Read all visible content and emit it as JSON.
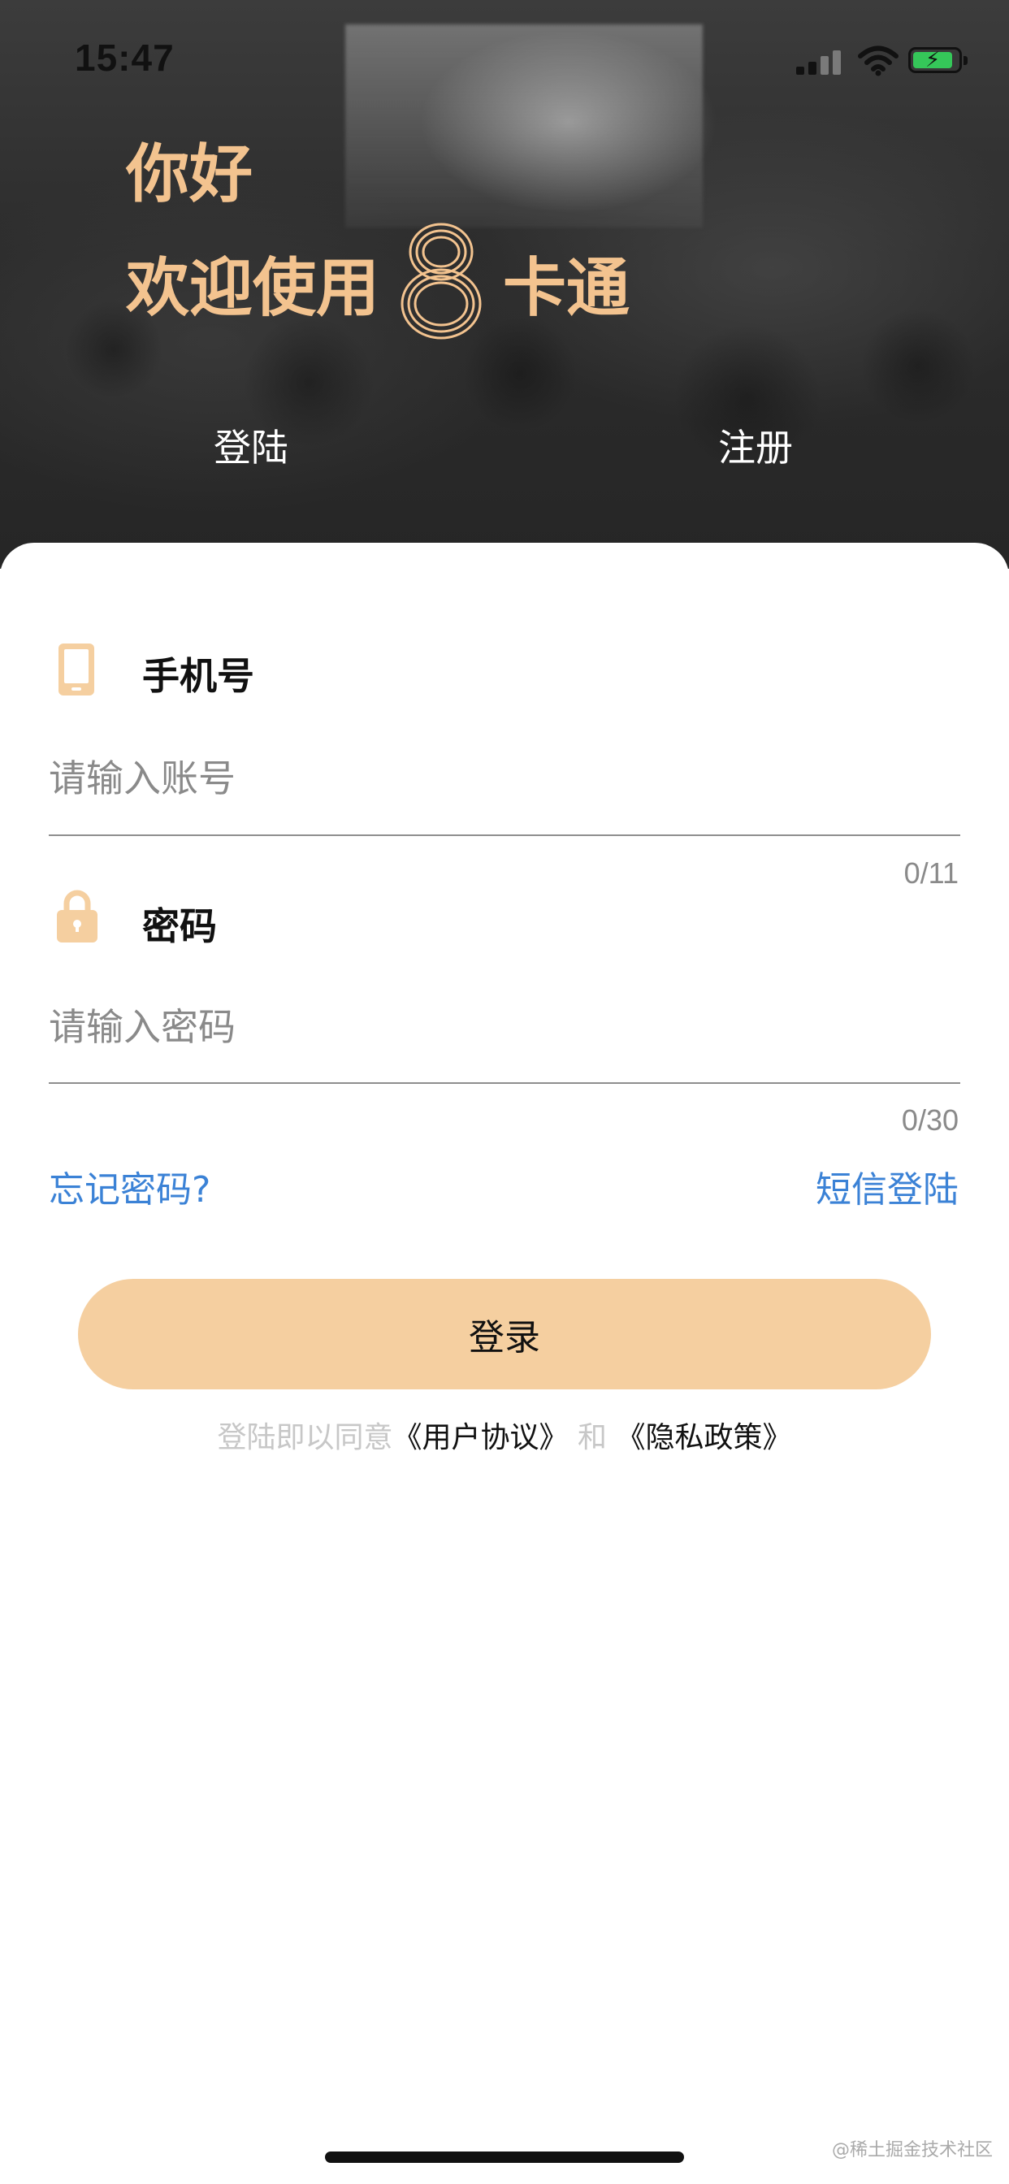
{
  "status_bar": {
    "time": "15:47"
  },
  "header": {
    "greeting_line1": "你好",
    "greeting_prefix": "欢迎使用",
    "greeting_number": "8",
    "greeting_suffix": "卡通",
    "tab_login": "登陆",
    "tab_register": "注册"
  },
  "form": {
    "phone": {
      "label": "手机号",
      "placeholder": "请输入账号",
      "value": "",
      "counter": "0/11",
      "icon": "phone-icon"
    },
    "password": {
      "label": "密码",
      "placeholder": "请输入密码",
      "value": "",
      "counter": "0/30",
      "icon": "lock-icon"
    },
    "forgot_link": "忘记密码?",
    "sms_link": "短信登陆",
    "login_button": "登录"
  },
  "agreement": {
    "prefix": "登陆即以同意",
    "user_agreement": "《用户协议》",
    "and": "和",
    "privacy_policy": "《隐私政策》"
  },
  "watermark": "@稀土掘金技术社区",
  "colors": {
    "accent": "#f3c38f",
    "button": "#f5cfa0",
    "link": "#3b82d6",
    "battery": "#35c759"
  }
}
